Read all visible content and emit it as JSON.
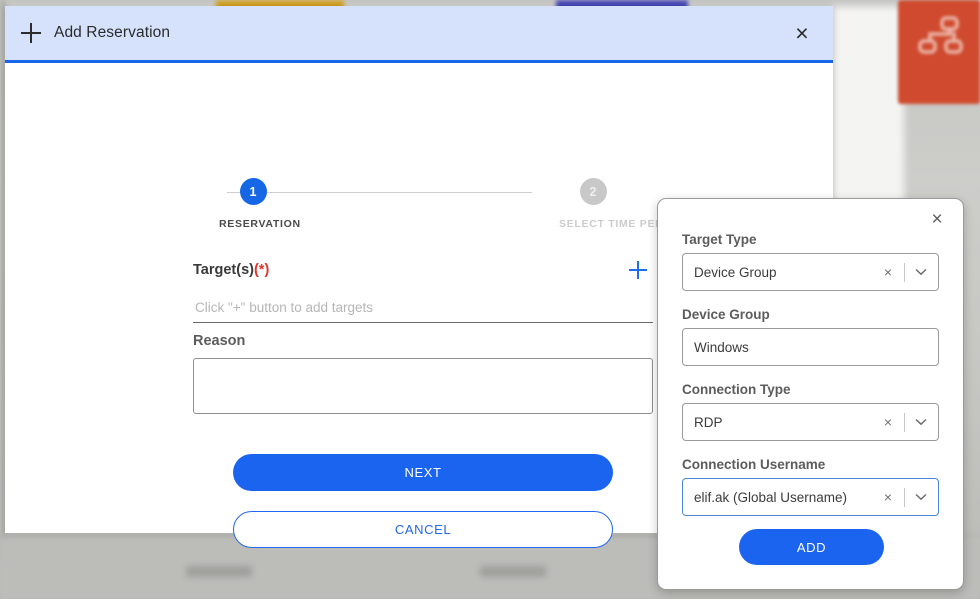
{
  "dialog": {
    "title": "Add Reservation",
    "plus_icon": "plus-icon",
    "close_icon": "×",
    "stepper": [
      {
        "number": "1",
        "label": "RESERVATION",
        "state": "active"
      },
      {
        "number": "2",
        "label": "SELECT TIME PERIOD",
        "state": "inactive"
      }
    ],
    "targets": {
      "label": "Target(s)",
      "required_marker": "(*)",
      "placeholder": "Click \"+\" button to add targets",
      "value": "",
      "add_icon": "plus-icon"
    },
    "reason": {
      "label": "Reason",
      "value": "",
      "placeholder": ""
    },
    "next_label": "NEXT",
    "cancel_label": "CANCEL"
  },
  "side_panel": {
    "close_icon": "×",
    "fields": [
      {
        "label": "Target Type",
        "value": "Device Group",
        "clear_icon": "×",
        "has_clear": true,
        "has_chevron": true,
        "focused": false
      },
      {
        "label": "Device Group",
        "value": "Windows",
        "clear_icon": "",
        "has_clear": false,
        "has_chevron": false,
        "focused": false
      },
      {
        "label": "Connection Type",
        "value": "RDP",
        "clear_icon": "×",
        "has_clear": true,
        "has_chevron": true,
        "focused": false
      },
      {
        "label": "Connection Username",
        "value": "elif.ak (Global Username)",
        "clear_icon": "×",
        "has_clear": true,
        "has_chevron": true,
        "focused": true
      }
    ],
    "add_label": "ADD"
  },
  "colors": {
    "header_bg": "#d6e2fb",
    "accent_blue": "#1b64ef",
    "header_rule": "#1967e8",
    "required_red": "#e0342c",
    "focus_border": "#4b88d0",
    "step_inactive": "#c8c8c8",
    "background_card_red": "#cf4a2e",
    "background_card_gold": "#d8a524",
    "background_card_indigo": "#4949bb"
  }
}
